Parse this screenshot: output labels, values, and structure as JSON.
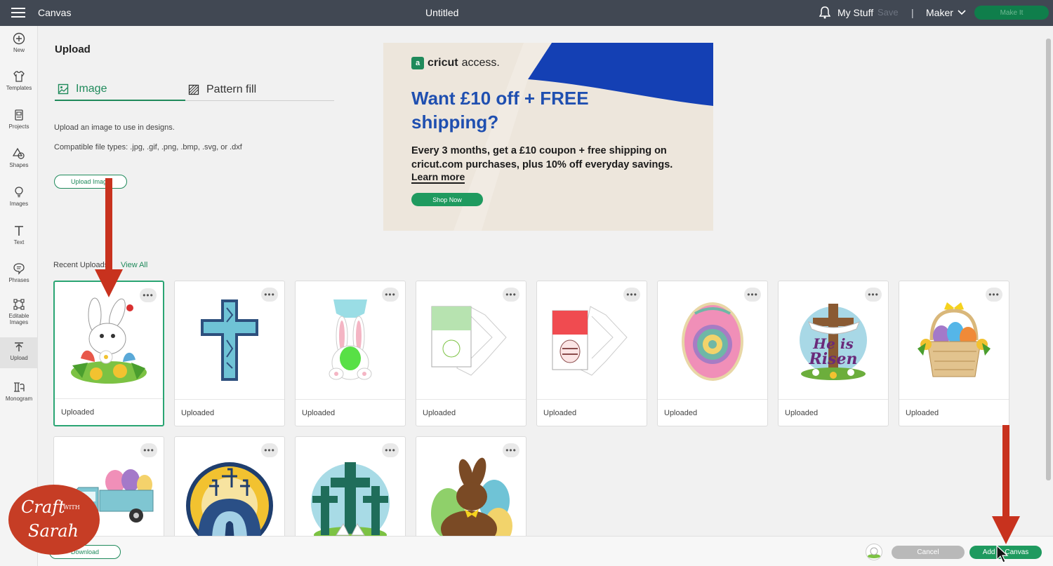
{
  "topbar": {
    "app_name": "Canvas",
    "doc_title": "Untitled",
    "my_stuff": "My Stuff",
    "save": "Save",
    "divider": "|",
    "machine": "Maker",
    "make_it": "Make It"
  },
  "nav": {
    "items": [
      {
        "label": "New",
        "icon": "plus-circle-icon"
      },
      {
        "label": "Templates",
        "icon": "shirt-icon"
      },
      {
        "label": "Projects",
        "icon": "projects-icon"
      },
      {
        "label": "Shapes",
        "icon": "shapes-icon"
      },
      {
        "label": "Images",
        "icon": "lightbulb-icon"
      },
      {
        "label": "Text",
        "icon": "text-icon"
      },
      {
        "label": "Phrases",
        "icon": "speech-bubble-icon"
      },
      {
        "label": "Editable Images",
        "icon": "editable-images-icon"
      },
      {
        "label": "Upload",
        "icon": "upload-icon"
      },
      {
        "label": "Monogram",
        "icon": "monogram-icon"
      }
    ]
  },
  "upload": {
    "title": "Upload",
    "tab_image": "Image",
    "tab_pattern": "Pattern fill",
    "description": "Upload an image to use in designs.",
    "file_types": "Compatible file types: .jpg, .gif, .png, .bmp, .svg, or .dxf",
    "upload_button": "Upload Image"
  },
  "ad": {
    "brand": "cricut",
    "brand_suffix": "access.",
    "headline": "Want £10 off + FREE shipping?",
    "body": "Every 3 months, get a £10 coupon + free shipping on cricut.com purchases, plus 10% off everyday savings.",
    "learn_more": "Learn more",
    "shop_now": "Shop Now"
  },
  "recent": {
    "label": "Recent Uploads",
    "view_all": "View All",
    "cards": [
      {
        "name": "bunny-flowers",
        "status": "Uploaded"
      },
      {
        "name": "blue-cross",
        "status": "Uploaded"
      },
      {
        "name": "bunny-egg-holder",
        "status": "Uploaded"
      },
      {
        "name": "green-envelope",
        "status": "Uploaded"
      },
      {
        "name": "red-envelope",
        "status": "Uploaded"
      },
      {
        "name": "mandala-egg",
        "status": "Uploaded"
      },
      {
        "name": "he-is-risen",
        "status": "Uploaded"
      },
      {
        "name": "easter-basket",
        "status": "Uploaded"
      },
      {
        "name": "egg-truck",
        "status": ""
      },
      {
        "name": "tomb-circle",
        "status": ""
      },
      {
        "name": "three-crosses",
        "status": ""
      },
      {
        "name": "chocolate-bunny",
        "status": ""
      }
    ],
    "more": "•••"
  },
  "bottom": {
    "download": "Download",
    "cancel": "Cancel",
    "add_to_canvas": "Add to Canvas"
  },
  "watermark": {
    "line1": "Craft",
    "with": "WITH",
    "line2": "Sarah"
  },
  "colors": {
    "accent": "#1f8a5b",
    "topbar": "#414853",
    "arrow": "#c8321e",
    "ad_blue": "#1440b4"
  }
}
